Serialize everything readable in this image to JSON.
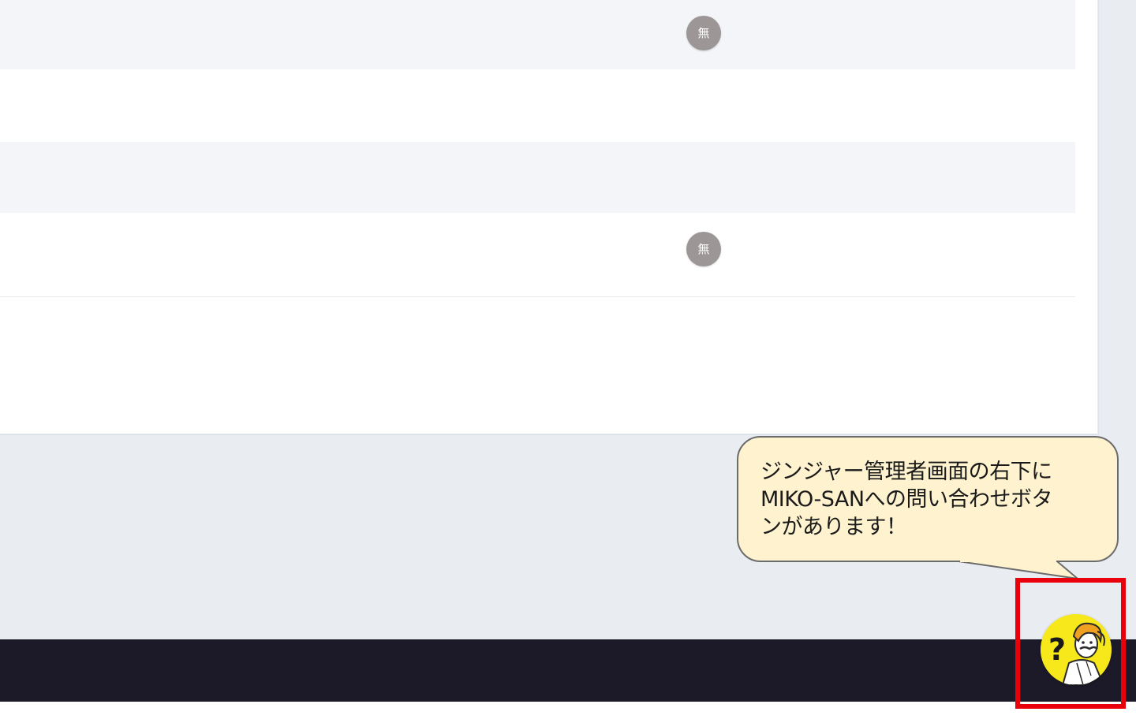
{
  "table": {
    "rows": [
      {
        "badge": "無"
      },
      {
        "badge": ""
      },
      {
        "badge": ""
      },
      {
        "badge": "無"
      },
      {
        "badge": ""
      }
    ]
  },
  "callout": {
    "lines": [
      "ジンジャー管理者画面の右下に",
      "MIKO-SANへの問い合わせボタ",
      "ンがあります！"
    ]
  },
  "help_button": {
    "symbol": "?",
    "icon": "miko-san-mascot-icon"
  },
  "colors": {
    "highlight": "#e8000b",
    "callout_bg": "#fff3cf",
    "footer": "#1c1a29",
    "badge": "#9c9697",
    "help_button_bg": "#f6e81a"
  }
}
